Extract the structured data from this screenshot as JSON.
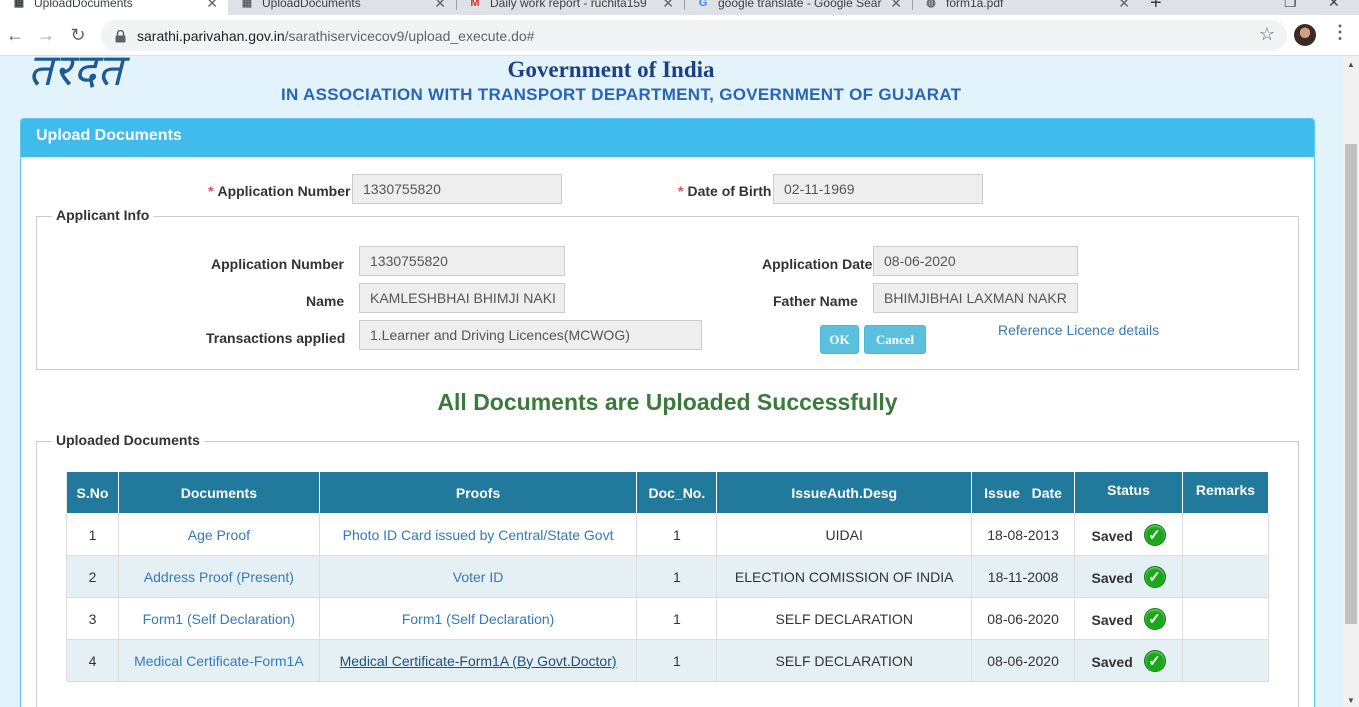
{
  "browser": {
    "tabs": [
      {
        "title": "UploadDocuments",
        "favicon": "page-icon",
        "active": true
      },
      {
        "title": "UploadDocuments",
        "favicon": "page-icon",
        "active": false
      },
      {
        "title": "Daily work report - ruchita159",
        "favicon": "gmail-icon",
        "active": false
      },
      {
        "title": "google translate - Google Sear",
        "favicon": "google-icon",
        "active": false
      },
      {
        "title": "form1a.pdf",
        "favicon": "globe-icon",
        "active": false
      }
    ],
    "url_host": "sarathi.parivahan.gov.in",
    "url_path": "/sarathiservicecov9/upload_execute.do#"
  },
  "header": {
    "logo_text": "तरदत",
    "gov_title": "Government of India",
    "assoc_title": "IN ASSOCIATION WITH TRANSPORT DEPARTMENT, GOVERNMENT OF GUJARAT"
  },
  "panel": {
    "title": "Upload Documents",
    "search": {
      "app_no_label": "Application Number",
      "app_no_value": "1330755820",
      "dob_label": "Date of Birth",
      "dob_value": "02-11-1969"
    },
    "applicant_info": {
      "legend": "Applicant Info",
      "app_no_label": "Application Number",
      "app_no_value": "1330755820",
      "app_date_label": "Application Date",
      "app_date_value": "08-06-2020",
      "name_label": "Name",
      "name_value": "KAMLESHBHAI BHIMJI NAKI",
      "father_label": "Father Name",
      "father_value": "BHIMJIBHAI LAXMAN NAKR",
      "trans_label": "Transactions applied",
      "trans_value": "1.Learner and Driving Licences(MCWOG)",
      "ok_label": "OK",
      "cancel_label": "Cancel",
      "ref_link": "Reference Licence details"
    },
    "success_message": "All Documents are Uploaded Successfully",
    "uploaded": {
      "legend": "Uploaded Documents",
      "columns": [
        "S.No",
        "Documents",
        "Proofs",
        "Doc_No.",
        "IssueAuth.Desg",
        "Issue   Date",
        "Status",
        "Remarks"
      ],
      "rows": [
        {
          "sno": "1",
          "document": "Age Proof",
          "proof": "Photo ID Card issued by Central/State Govt",
          "doc_no": "1",
          "issue_auth": "UIDAI",
          "issue_date": "18-08-2013",
          "status": "Saved",
          "remarks": ""
        },
        {
          "sno": "2",
          "document": "Address Proof (Present)",
          "proof": "Voter ID",
          "doc_no": "1",
          "issue_auth": "ELECTION COMISSION OF INDIA",
          "issue_date": "18-11-2008",
          "status": "Saved",
          "remarks": ""
        },
        {
          "sno": "3",
          "document": "Form1 (Self Declaration)",
          "proof": "Form1 (Self Declaration)",
          "doc_no": "1",
          "issue_auth": "SELF DECLARATION",
          "issue_date": "08-06-2020",
          "status": "Saved",
          "remarks": ""
        },
        {
          "sno": "4",
          "document": "Medical Certificate-Form1A",
          "proof": "Medical Certificate-Form1A (By Govt.Doctor)",
          "doc_no": "1",
          "issue_auth": "SELF DECLARATION",
          "issue_date": "08-06-2020",
          "status": "Saved",
          "remarks": ""
        }
      ]
    }
  },
  "colors": {
    "panel_header": "#3fbcec",
    "table_header": "#217a9b",
    "success_text": "#3c7a3c",
    "page_bg": "#e3f3fb"
  }
}
